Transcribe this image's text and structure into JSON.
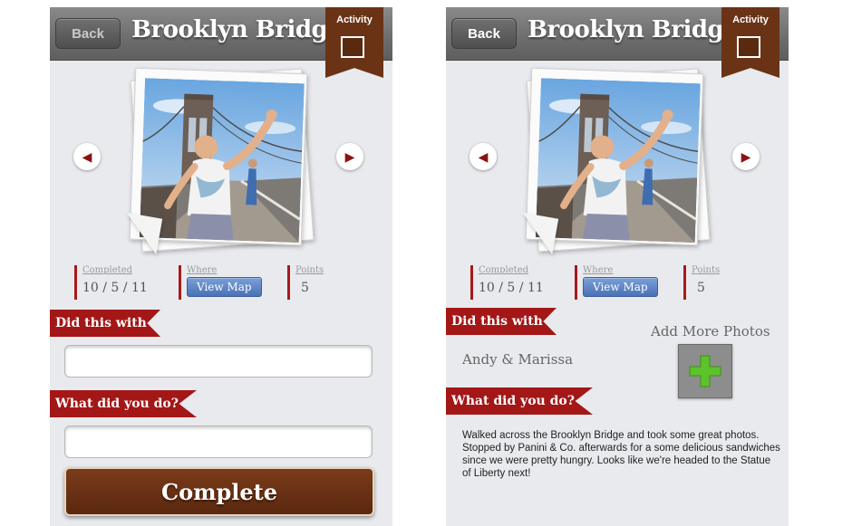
{
  "screens": [
    {
      "header": {
        "back_label": "Back",
        "title": "Brooklyn Bridge",
        "badge_label": "Activity"
      },
      "stats": {
        "completed_label": "Completed",
        "completed_value": "10 / 5 / 11",
        "where_label": "Where",
        "map_button_label": "View Map",
        "points_label": "Points",
        "points_value": "5"
      },
      "did_this_with_label": "Did this with",
      "what_did_you_do_label": "What did you do?",
      "complete_button_label": "Complete"
    },
    {
      "header": {
        "back_label": "Back",
        "title": "Brooklyn Bridge",
        "badge_label": "Activity"
      },
      "stats": {
        "completed_label": "Completed",
        "completed_value": "10 / 5 / 11",
        "where_label": "Where",
        "map_button_label": "View Map",
        "points_label": "Points",
        "points_value": "5"
      },
      "did_this_with_label": "Did this with",
      "companions": "Andy & Marissa",
      "add_photos_label": "Add More Photos",
      "what_did_you_do_label": "What did you do?",
      "description": "Walked across the Brooklyn Bridge and took some great photos. Stopped by Panini & Co. afterwards for a some delicious sandwiches since we were pretty hungry. Looks like we're headed to the Statue of Liberty next!"
    }
  ],
  "colors": {
    "header": "#6f6f6f",
    "badge": "#6b3316",
    "ribbon": "#a31717",
    "complete_button": "#6a3013",
    "map_button": "#5b82c4",
    "add_icon": "#5cc32b"
  },
  "icons": [
    "chevron-left-icon",
    "chevron-right-icon",
    "checkbox-icon",
    "plus-icon"
  ]
}
